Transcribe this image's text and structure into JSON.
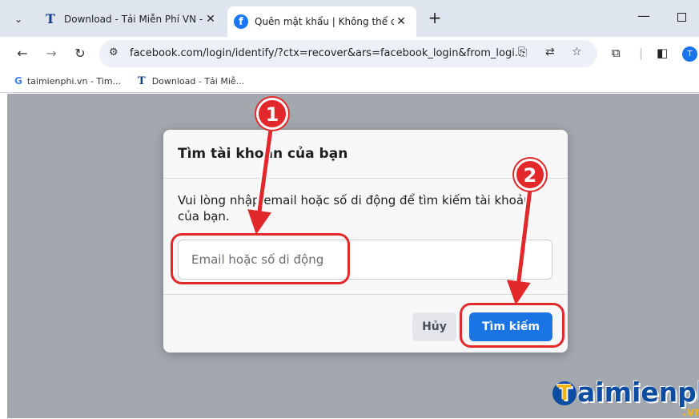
{
  "browser": {
    "tabs": [
      {
        "title": "Download - Tải Miễn Phí VN - P",
        "favicon": "T"
      },
      {
        "title": "Quên mật khẩu | Không thể đă",
        "favicon": "f"
      }
    ],
    "url": "facebook.com/login/identify/?ctx=recover&ars=facebook_login&from_logi...",
    "profile_initial": "T",
    "bookmarks": [
      {
        "label": "taimienphi.vn - Tim...",
        "icon": "G"
      },
      {
        "label": "Download - Tải Miễ...",
        "icon": "T"
      }
    ]
  },
  "dialog": {
    "title": "Tìm tài khoản của bạn",
    "description": "Vui lòng nhập email hoặc số di động để tìm kiếm tài khoản của bạn.",
    "input_placeholder": "Email hoặc số di động",
    "cancel_label": "Hủy",
    "search_label": "Tìm kiếm"
  },
  "annotations": {
    "step1": "1",
    "step2": "2",
    "color": "#e3282b"
  },
  "watermark": {
    "initial": "T",
    "text": "aimienphi",
    "suffix": ".vn"
  }
}
